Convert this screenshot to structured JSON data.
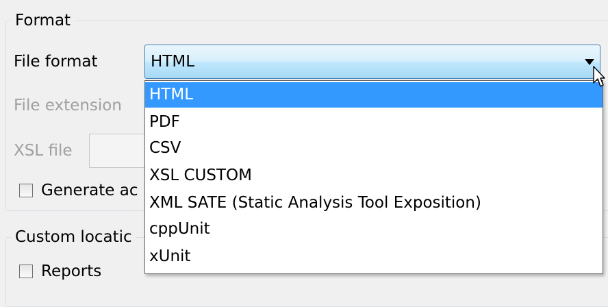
{
  "format_group": {
    "title": "Format",
    "file_format_label": "File format",
    "file_format_value": "HTML",
    "file_extension_label": "File extension",
    "xsl_file_label": "XSL file",
    "generate_checkbox_label": "Generate ac"
  },
  "dropdown": {
    "options": [
      "HTML",
      "PDF",
      "CSV",
      "XSL CUSTOM",
      "XML SATE (Static Analysis Tool Exposition)",
      "cppUnit",
      "xUnit"
    ],
    "selected_option": "HTML"
  },
  "custom_location_group": {
    "title": "Custom locatic",
    "reports_checkbox_label": "Reports"
  },
  "colors": {
    "selection_highlight": "#3399ff",
    "combo_border": "#3c7fb1",
    "disabled_text": "#a0a0a0"
  },
  "icons": {
    "dropdown_arrow": "chevron-down-icon",
    "cursor": "mouse-pointer-icon"
  }
}
